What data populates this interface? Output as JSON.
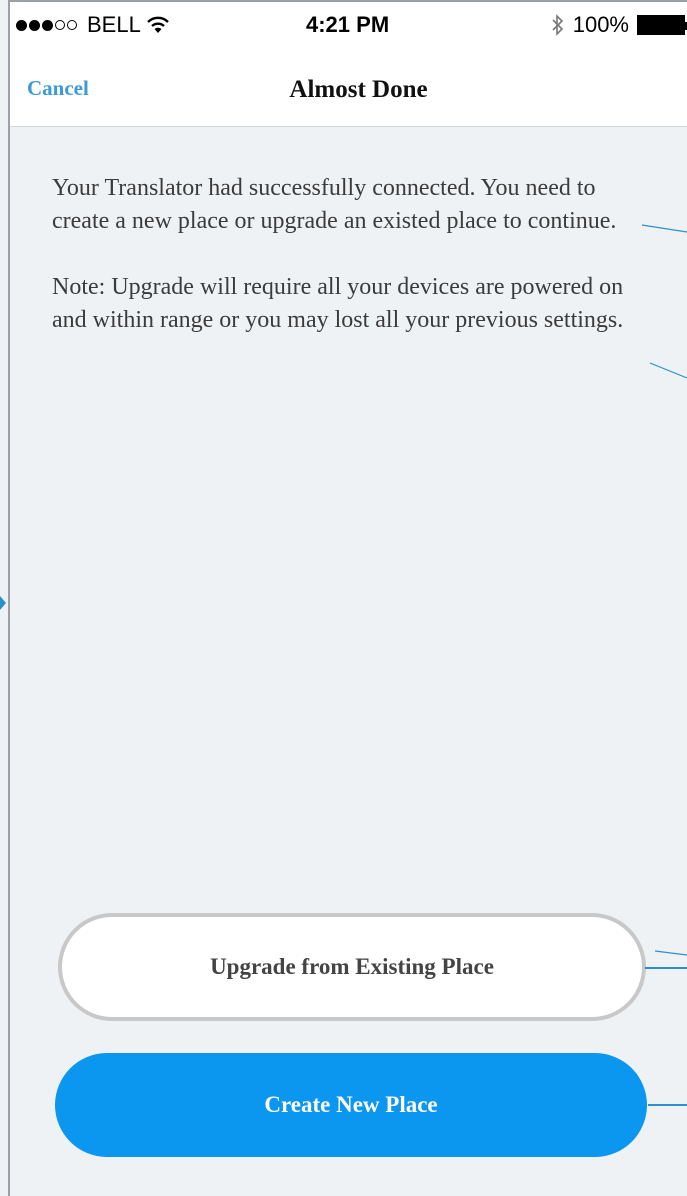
{
  "status_bar": {
    "carrier": "BELL",
    "time": "4:21 PM",
    "battery": "100%",
    "icons": [
      "signal-dots-icon",
      "wifi-icon",
      "bluetooth-icon",
      "battery-icon"
    ]
  },
  "nav": {
    "cancel_label": "Cancel",
    "title": "Almost Done"
  },
  "content": {
    "message": "Your Translator had successfully connected. You need to create a new place or upgrade an existed place to continue.",
    "note": "Note: Upgrade will require all your devices are powered on and within range or you may lost all your previous settings."
  },
  "buttons": {
    "upgrade_label": "Upgrade from Existing Place",
    "create_label": "Create New Place"
  },
  "colors": {
    "accent": "#0b97ef",
    "cancel_link": "#3a9bd8",
    "background": "#eff2f5",
    "annotation_line": "#2a8fd0"
  }
}
